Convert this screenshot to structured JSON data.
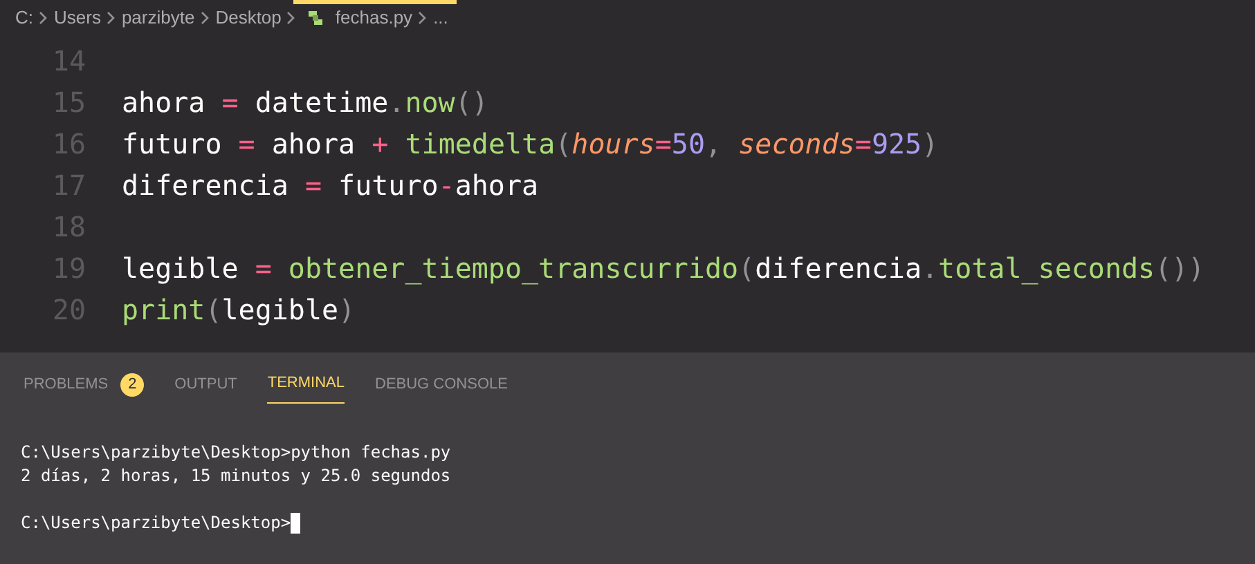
{
  "breadcrumb": {
    "items": [
      "C:",
      "Users",
      "parzibyte",
      "Desktop",
      "fechas.py",
      "..."
    ]
  },
  "editor": {
    "lines": [
      {
        "number": "14"
      },
      {
        "number": "15",
        "tokens": [
          {
            "kind": "plain",
            "text": "ahora "
          },
          {
            "kind": "op",
            "text": "="
          },
          {
            "kind": "plain",
            "text": " datetime"
          },
          {
            "kind": "punct",
            "text": "."
          },
          {
            "kind": "fn",
            "text": "now"
          },
          {
            "kind": "punct",
            "text": "()"
          }
        ]
      },
      {
        "number": "16",
        "tokens": [
          {
            "kind": "plain",
            "text": "futuro "
          },
          {
            "kind": "op",
            "text": "="
          },
          {
            "kind": "plain",
            "text": " ahora "
          },
          {
            "kind": "op",
            "text": "+ "
          },
          {
            "kind": "fn",
            "text": "timedelta"
          },
          {
            "kind": "punct",
            "text": "("
          },
          {
            "kind": "param",
            "text": "hours"
          },
          {
            "kind": "op",
            "text": "="
          },
          {
            "kind": "num",
            "text": "50"
          },
          {
            "kind": "punct",
            "text": ", "
          },
          {
            "kind": "param",
            "text": "seconds"
          },
          {
            "kind": "op",
            "text": "="
          },
          {
            "kind": "num",
            "text": "925"
          },
          {
            "kind": "punct",
            "text": ")"
          }
        ]
      },
      {
        "number": "17",
        "tokens": [
          {
            "kind": "plain",
            "text": "diferencia "
          },
          {
            "kind": "op",
            "text": "="
          },
          {
            "kind": "plain",
            "text": " futuro"
          },
          {
            "kind": "op",
            "text": "-"
          },
          {
            "kind": "plain",
            "text": "ahora"
          }
        ]
      },
      {
        "number": "18"
      },
      {
        "number": "19",
        "tokens": [
          {
            "kind": "plain",
            "text": "legible "
          },
          {
            "kind": "op",
            "text": "= "
          },
          {
            "kind": "fn",
            "text": "obtener_tiempo_transcurrido"
          },
          {
            "kind": "punct",
            "text": "("
          },
          {
            "kind": "plain",
            "text": "diferencia"
          },
          {
            "kind": "punct",
            "text": "."
          },
          {
            "kind": "fn",
            "text": "total_seconds"
          },
          {
            "kind": "punct",
            "text": "())"
          }
        ]
      },
      {
        "number": "20",
        "tokens": [
          {
            "kind": "fn",
            "text": "print"
          },
          {
            "kind": "punct",
            "text": "("
          },
          {
            "kind": "plain",
            "text": "legible"
          },
          {
            "kind": "punct",
            "text": ")"
          }
        ]
      }
    ]
  },
  "panel": {
    "tabs": [
      {
        "label": "PROBLEMS",
        "badge": "2",
        "selected": false
      },
      {
        "label": "OUTPUT",
        "selected": false
      },
      {
        "label": "TERMINAL",
        "selected": true
      },
      {
        "label": "DEBUG CONSOLE",
        "selected": false
      }
    ],
    "terminal": {
      "lines": [
        "C:\\Users\\parzibyte\\Desktop>python fechas.py",
        "2 días, 2 horas, 15 minutos y 25.0 segundos"
      ],
      "prompt": "C:\\Users\\parzibyte\\Desktop>"
    }
  }
}
